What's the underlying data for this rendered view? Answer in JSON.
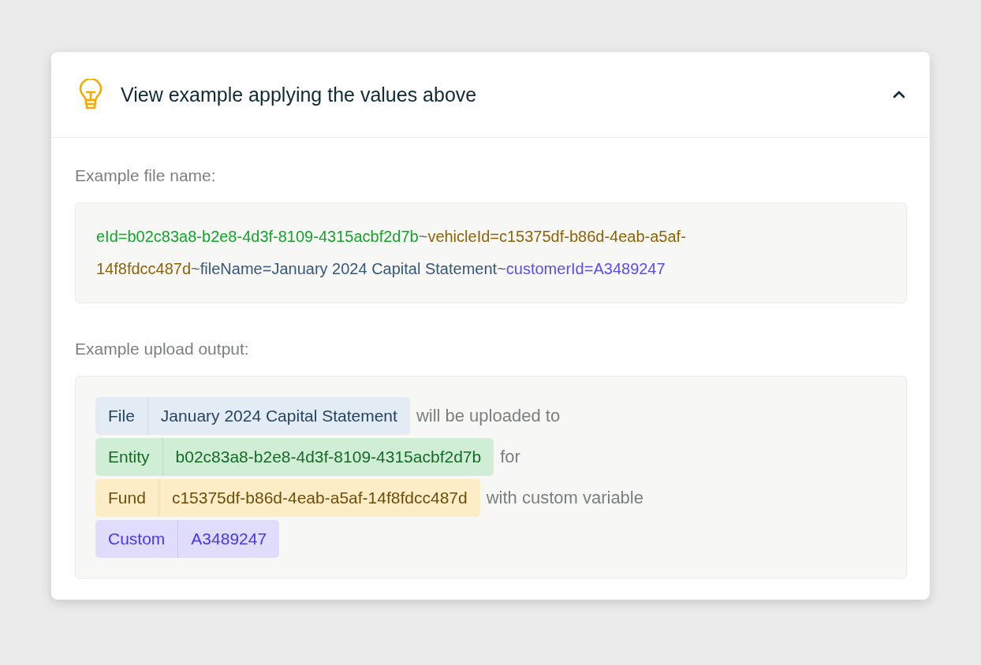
{
  "panel": {
    "title": "View example applying the values above",
    "expanded": true
  },
  "file_name": {
    "label": "Example file name:",
    "segments": [
      {
        "text": "eId=b02c83a8-b2e8-4d3f-8109-4315acbf2d7b",
        "color": "#13a52b"
      },
      {
        "text": "~",
        "color": "#5d6b6b"
      },
      {
        "text": "vehicleId=c15375df-b86d-4eab-a5af-14f8fdcc487d",
        "color": "#8c6408"
      },
      {
        "text": "~",
        "color": "#5d6b6b"
      },
      {
        "text": "fileName=January 2024 Capital Statement",
        "color": "#35587a"
      },
      {
        "text": "~",
        "color": "#5d6b6b"
      },
      {
        "text": "customerId=A3489247",
        "color": "#5b4cf5"
      }
    ]
  },
  "upload_output": {
    "label": "Example upload output:",
    "rows": [
      {
        "tag": "File",
        "value": "January 2024 Capital Statement",
        "color": "#e3ebf4",
        "text": "will be uploaded to"
      },
      {
        "tag": "Entity",
        "value": "b02c83a8-b2e8-4d3f-8109-4315acbf2d7b",
        "color": "#d0edd5",
        "text": "for"
      },
      {
        "tag": "Fund",
        "value": "c15375df-b86d-4eab-a5af-14f8fdcc487d",
        "color": "#fdedc6",
        "text": "with custom variable"
      },
      {
        "tag": "Custom",
        "value": "A3489247",
        "color": "#dfdcfc"
      }
    ]
  }
}
